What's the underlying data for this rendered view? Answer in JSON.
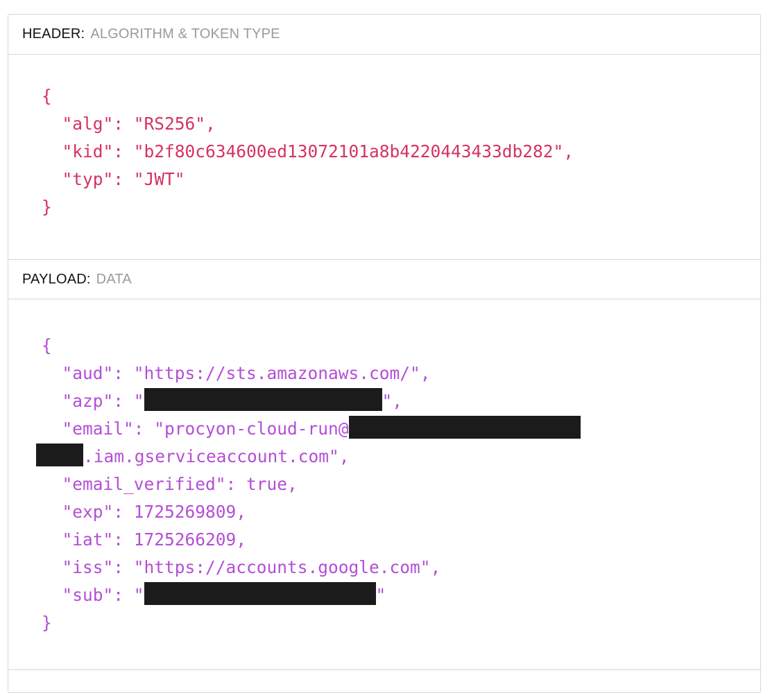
{
  "header": {
    "label": "HEADER:",
    "sub": "ALGORITHM & TOKEN TYPE",
    "json_lines": [
      "{",
      "  \"alg\": \"RS256\",",
      "  \"kid\": \"b2f80c634600ed13072101a8b4220443433db282\",",
      "  \"typ\": \"JWT\"",
      "}"
    ],
    "color": "#d5335f"
  },
  "payload": {
    "label": "PAYLOAD:",
    "sub": "DATA",
    "color": "#b44ed6",
    "open_brace": "{",
    "close_brace": "}",
    "aud_line": "  \"aud\": \"https://sts.amazonaws.com/\",",
    "azp_prefix": "  \"azp\": \"",
    "azp_suffix": "\",",
    "email_prefix": "  \"email\": \"procyon-cloud-run@",
    "email_suffix": ".iam.gserviceaccount.com\",",
    "email_verified_line": "  \"email_verified\": true,",
    "exp_line": "  \"exp\": 1725269809,",
    "iat_line": "  \"iat\": 1725266209,",
    "iss_line": "  \"iss\": \"https://accounts.google.com\",",
    "sub_prefix": "  \"sub\": \"",
    "sub_suffix": "\""
  }
}
